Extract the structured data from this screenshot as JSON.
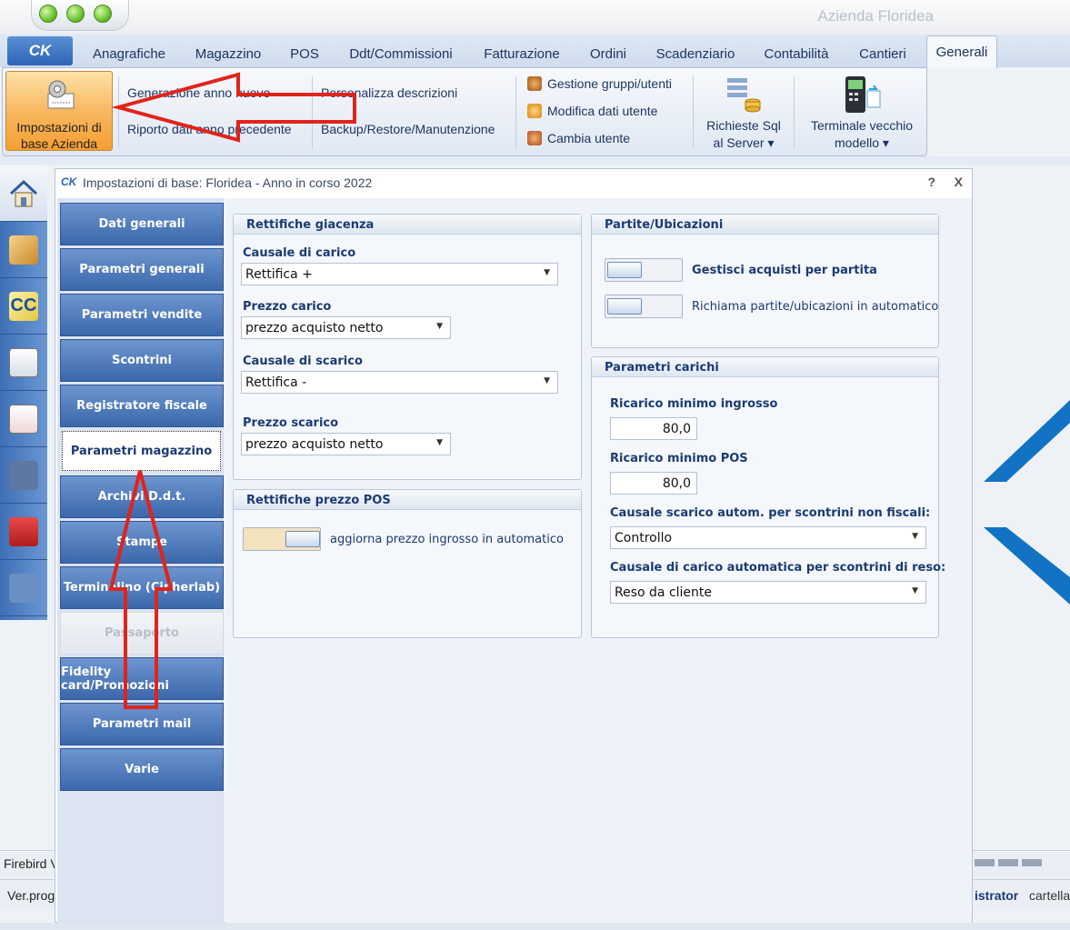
{
  "window": {
    "title": "Azienda Floridea"
  },
  "menu": {
    "logo": "CK",
    "tabs": [
      "Anagrafiche",
      "Magazzino",
      "POS",
      "Ddt/Commissioni",
      "Fatturazione",
      "Ordini",
      "Scadenziario",
      "Contabilità",
      "Cantieri",
      "Generali"
    ],
    "active_tab": "Generali"
  },
  "ribbon": {
    "impostazioni_line1": "Impostazioni di",
    "impostazioni_line2": "base Azienda",
    "generazione": "Generazione anno nuovo",
    "riporto": "Riporto dati anno precedente",
    "personalizza": "Personalizza descrizioni",
    "backup": "Backup/Restore/Manutenzione",
    "gestione_gruppi": "Gestione gruppi/utenti",
    "modifica_dati": "Modifica dati utente",
    "cambia_utente": "Cambia utente",
    "richieste_line1": "Richieste Sql",
    "richieste_line2": "al Server ▾",
    "terminale_line1": "Terminale vecchio",
    "terminale_line2": "modello ▾"
  },
  "statusbar": {
    "left1": "Firebird V",
    "left2": "Ver.prog",
    "right": "istrator",
    "right2": "cartella"
  },
  "dialog": {
    "logo": "CK",
    "title": "Impostazioni di base: Floridea - Anno in corso 2022",
    "help": "?",
    "close": "X",
    "nav": [
      "Dati generali",
      "Parametri generali",
      "Parametri vendite",
      "Scontrini",
      "Registratore fiscale",
      "Parametri magazzino",
      "Archivi D.d.t.",
      "Stampe",
      "Terminalino (Cipherlab)",
      "Passaporto",
      "Fidelity card/Promozioni",
      "Parametri mail",
      "Varie"
    ],
    "active_nav": "Parametri magazzino",
    "disabled_nav": "Passaporto",
    "rettifiche_giacenza": {
      "title": "Rettifiche giacenza",
      "causale_carico_label": "Causale di carico",
      "causale_carico_value": "Rettifica +",
      "prezzo_carico_label": "Prezzo carico",
      "prezzo_carico_value": "prezzo acquisto netto",
      "causale_scarico_label": "Causale di scarico",
      "causale_scarico_value": "Rettifica -",
      "prezzo_scarico_label": "Prezzo scarico",
      "prezzo_scarico_value": "prezzo acquisto netto"
    },
    "rettifiche_prezzo_pos": {
      "title": "Rettifiche prezzo POS",
      "toggle_label": "aggiorna prezzo ingrosso in automatico",
      "toggle_on": true
    },
    "partite": {
      "title": "Partite/Ubicazioni",
      "gestisci_label": "Gestisci acquisti per partita",
      "gestisci_on": false,
      "richiama_label": "Richiama partite/ubicazioni in automatico",
      "richiama_on": false
    },
    "parametri_carichi": {
      "title": "Parametri carichi",
      "ricarico_ingrosso_label": "Ricarico minimo ingrosso",
      "ricarico_ingrosso_value": "80,0",
      "ricarico_pos_label": "Ricarico minimo POS",
      "ricarico_pos_value": "80,0",
      "causale_scarico_auto_label": "Causale scarico autom. per scontrini non fiscali:",
      "causale_scarico_auto_value": "Controllo",
      "causale_carico_auto_label": "Causale di carico automatica per scontrini di reso:",
      "causale_carico_auto_value": "Reso da cliente"
    }
  },
  "colors": {
    "accent": "#3b67ab",
    "annotation": "#e0241b",
    "brand_k": "#1273c4"
  }
}
